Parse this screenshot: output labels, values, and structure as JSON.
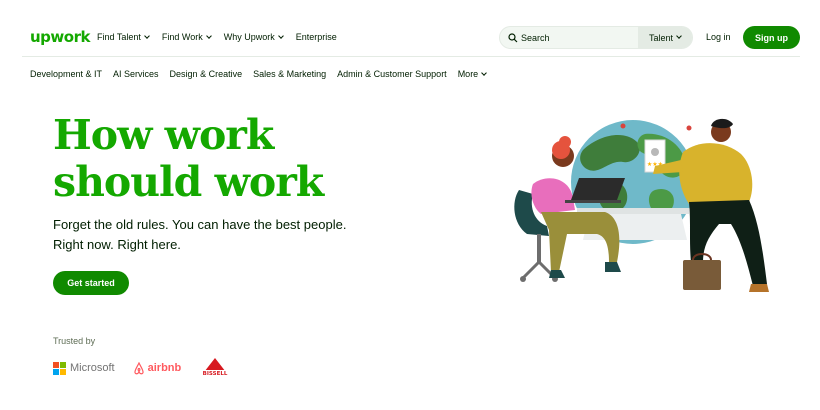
{
  "brand": {
    "logo_text": "upwork",
    "accent": "#14a800",
    "button_green": "#108a00"
  },
  "topnav": {
    "links": [
      {
        "label": "Find Talent",
        "dropdown": true
      },
      {
        "label": "Find Work",
        "dropdown": true
      },
      {
        "label": "Why Upwork",
        "dropdown": true
      },
      {
        "label": "Enterprise",
        "dropdown": false
      }
    ],
    "search": {
      "placeholder": "Search",
      "type_label": "Talent"
    },
    "login_label": "Log in",
    "signup_label": "Sign up"
  },
  "categories": [
    "Development & IT",
    "AI Services",
    "Design & Creative",
    "Sales & Marketing",
    "Admin & Customer Support",
    "More"
  ],
  "hero": {
    "headline_line1": "How work",
    "headline_line2": "should work",
    "sub_line1": "Forget the old rules. You can have the best people.",
    "sub_line2": "Right now. Right here.",
    "cta_label": "Get started",
    "illustration_icon": "people-working-globe-illustration"
  },
  "trusted": {
    "label": "Trusted by",
    "logos": [
      {
        "name": "microsoft-logo",
        "text": "Microsoft"
      },
      {
        "name": "airbnb-logo",
        "text": "airbnb"
      },
      {
        "name": "bissell-logo",
        "text": "BISSELL"
      }
    ]
  }
}
